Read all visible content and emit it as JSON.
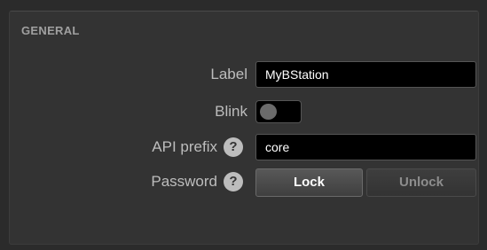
{
  "section": {
    "title": "GENERAL"
  },
  "fields": {
    "label": {
      "label": "Label",
      "value": "MyBStation"
    },
    "blink": {
      "label": "Blink",
      "state": "off"
    },
    "api_prefix": {
      "label": "API prefix",
      "help": "?",
      "value": "core"
    },
    "password": {
      "label": "Password",
      "help": "?",
      "lock_label": "Lock",
      "unlock_label": "Unlock"
    }
  },
  "colors": {
    "panel_bg": "#333333",
    "input_bg": "#000000",
    "label_text": "#bdbdbd",
    "title_text": "#a0a0a0"
  }
}
